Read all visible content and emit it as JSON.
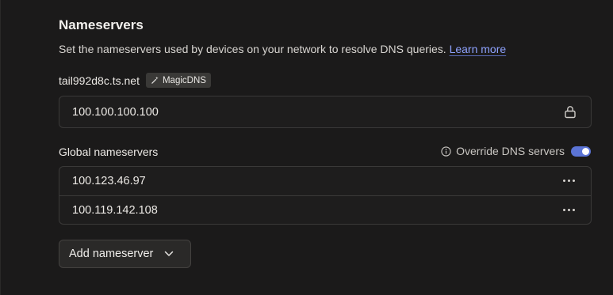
{
  "section": {
    "title": "Nameservers",
    "description": "Set the nameservers used by devices on your network to resolve DNS queries.",
    "learn_more": "Learn more"
  },
  "tailnet": {
    "name": "tail992d8c.ts.net",
    "badge": "MagicDNS",
    "nameserver": "100.100.100.100"
  },
  "global": {
    "label": "Global nameservers",
    "override_label": "Override DNS servers",
    "override_enabled": true,
    "nameservers": [
      "100.123.46.97",
      "100.119.142.108"
    ]
  },
  "add_button": "Add nameserver",
  "colors": {
    "accent": "#5b74d6",
    "link": "#8fa3ff",
    "background": "#1b1a1a"
  }
}
